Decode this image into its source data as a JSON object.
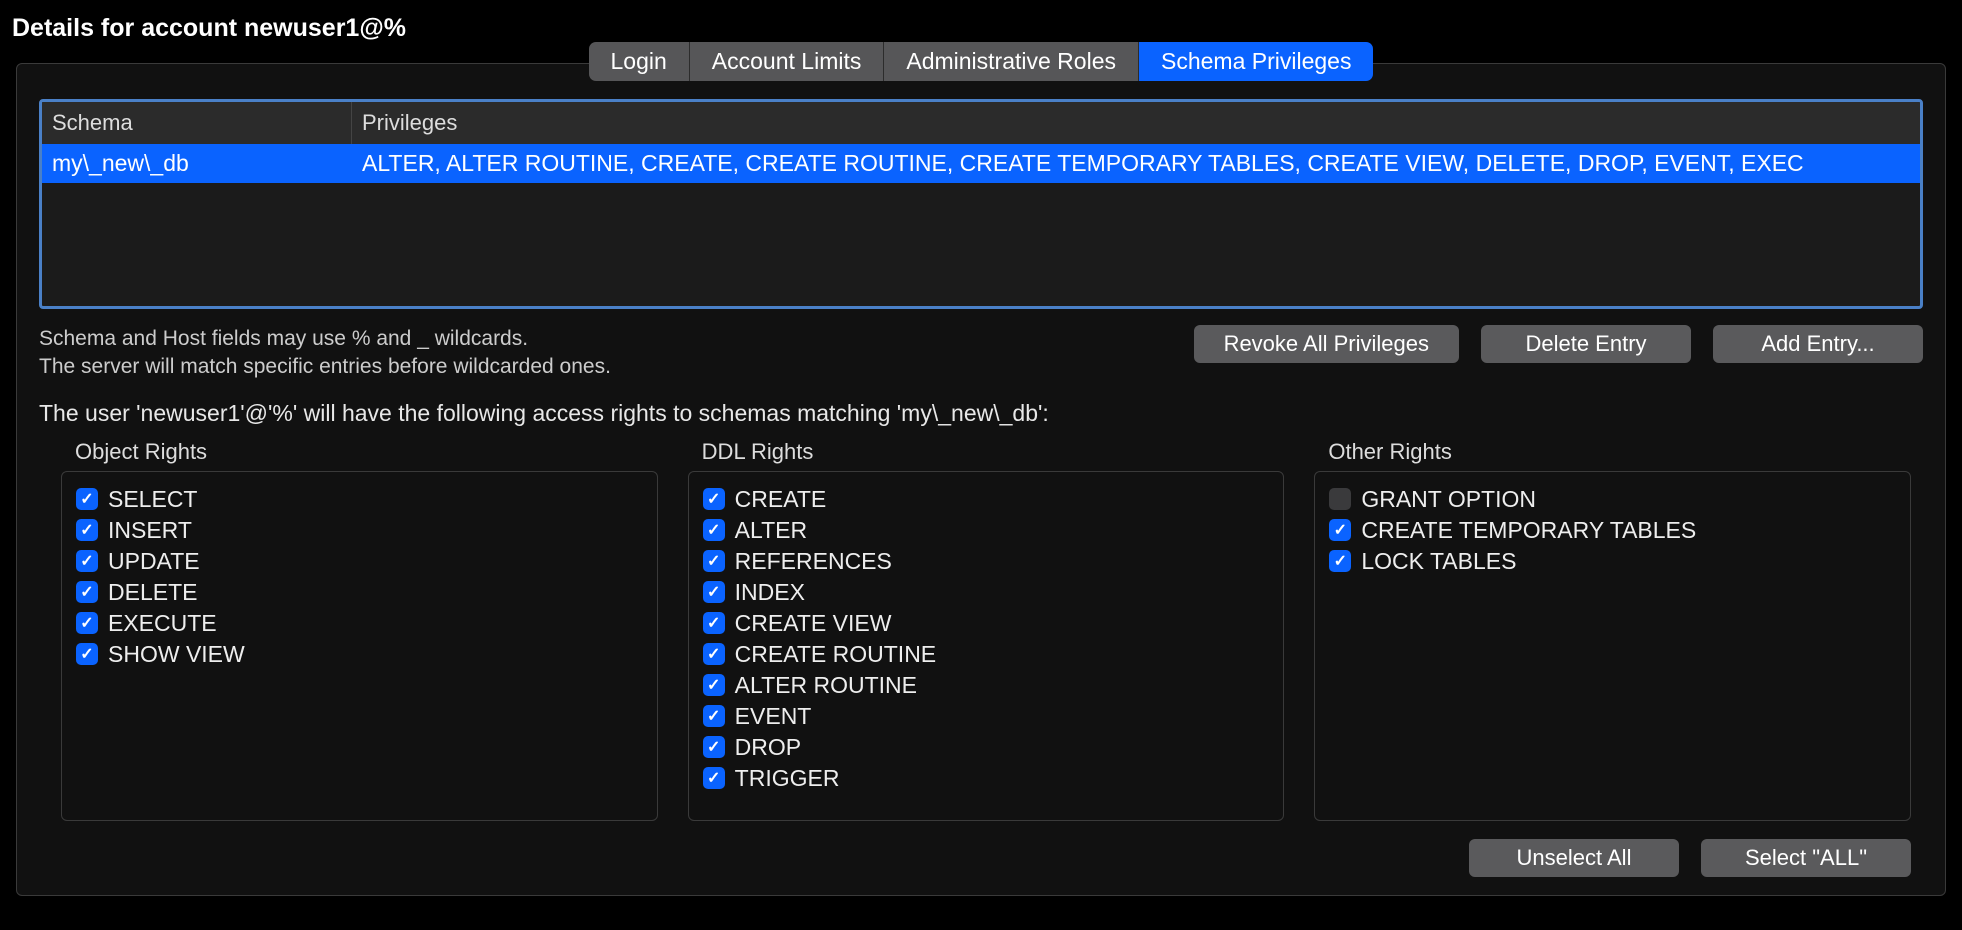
{
  "title": "Details for account newuser1@%",
  "tabs": [
    {
      "label": "Login",
      "active": false
    },
    {
      "label": "Account Limits",
      "active": false
    },
    {
      "label": "Administrative Roles",
      "active": false
    },
    {
      "label": "Schema Privileges",
      "active": true
    }
  ],
  "schema_table": {
    "headers": {
      "schema": "Schema",
      "privileges": "Privileges"
    },
    "rows": [
      {
        "schema": "my\\_new\\_db",
        "privileges": "ALTER, ALTER ROUTINE, CREATE, CREATE ROUTINE, CREATE TEMPORARY TABLES, CREATE VIEW, DELETE, DROP, EVENT, EXEC"
      }
    ]
  },
  "hint_line1": "Schema and Host fields may use % and _ wildcards.",
  "hint_line2": "The server will match specific entries before wildcarded ones.",
  "buttons": {
    "revoke": "Revoke All Privileges",
    "delete": "Delete Entry",
    "add": "Add Entry...",
    "unselect": "Unselect All",
    "select_all": "Select \"ALL\""
  },
  "access_sentence": "The user 'newuser1'@'%' will have the following access rights to schemas matching 'my\\_new\\_db':",
  "rights": {
    "object": {
      "title": "Object Rights",
      "items": [
        {
          "label": "SELECT",
          "checked": true
        },
        {
          "label": "INSERT",
          "checked": true
        },
        {
          "label": "UPDATE",
          "checked": true
        },
        {
          "label": "DELETE",
          "checked": true
        },
        {
          "label": "EXECUTE",
          "checked": true
        },
        {
          "label": "SHOW VIEW",
          "checked": true
        }
      ]
    },
    "ddl": {
      "title": "DDL Rights",
      "items": [
        {
          "label": "CREATE",
          "checked": true
        },
        {
          "label": "ALTER",
          "checked": true
        },
        {
          "label": "REFERENCES",
          "checked": true
        },
        {
          "label": "INDEX",
          "checked": true
        },
        {
          "label": "CREATE VIEW",
          "checked": true
        },
        {
          "label": "CREATE ROUTINE",
          "checked": true
        },
        {
          "label": "ALTER ROUTINE",
          "checked": true
        },
        {
          "label": "EVENT",
          "checked": true
        },
        {
          "label": "DROP",
          "checked": true
        },
        {
          "label": "TRIGGER",
          "checked": true
        }
      ]
    },
    "other": {
      "title": "Other Rights",
      "items": [
        {
          "label": "GRANT OPTION",
          "checked": false
        },
        {
          "label": "CREATE TEMPORARY TABLES",
          "checked": true
        },
        {
          "label": "LOCK TABLES",
          "checked": true
        }
      ]
    }
  }
}
